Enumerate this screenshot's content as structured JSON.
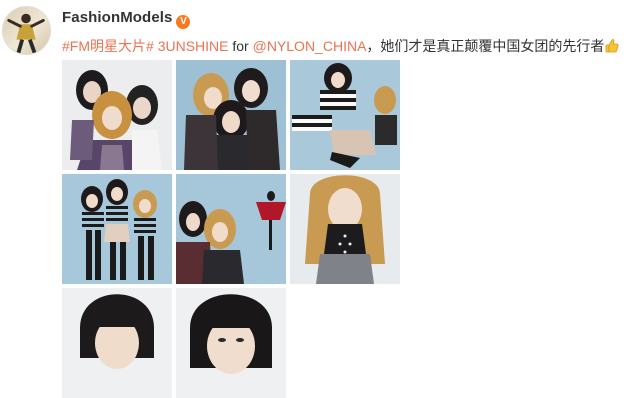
{
  "user": {
    "name": "FashionModels",
    "badge": "V",
    "avatar_icon": "fashion-model-avatar-icon"
  },
  "post": {
    "topic": "#FM明星大片#",
    "mention_group": "3UNSHINE",
    "for_word": "for",
    "mention_account": "@NYLON_CHINA",
    "text": "，她们才是真正颠覆中国女团的先行者",
    "emoji": "thumbs-up-icon"
  },
  "colors": {
    "link": "#eb7350",
    "badge": "#f77b1e",
    "text": "#333333"
  },
  "photos": [
    {
      "name": "photo-1",
      "description_icon": "three-women-photo"
    },
    {
      "name": "photo-2",
      "description_icon": "three-women-photo"
    },
    {
      "name": "photo-3",
      "description_icon": "women-lying-photo"
    },
    {
      "name": "photo-4",
      "description_icon": "three-women-standing-photo"
    },
    {
      "name": "photo-5",
      "description_icon": "two-women-photo"
    },
    {
      "name": "photo-6",
      "description_icon": "woman-portrait-photo"
    },
    {
      "name": "photo-7",
      "description_icon": "bob-hair-portrait-photo"
    },
    {
      "name": "photo-8",
      "description_icon": "bob-hair-portrait-photo"
    }
  ]
}
